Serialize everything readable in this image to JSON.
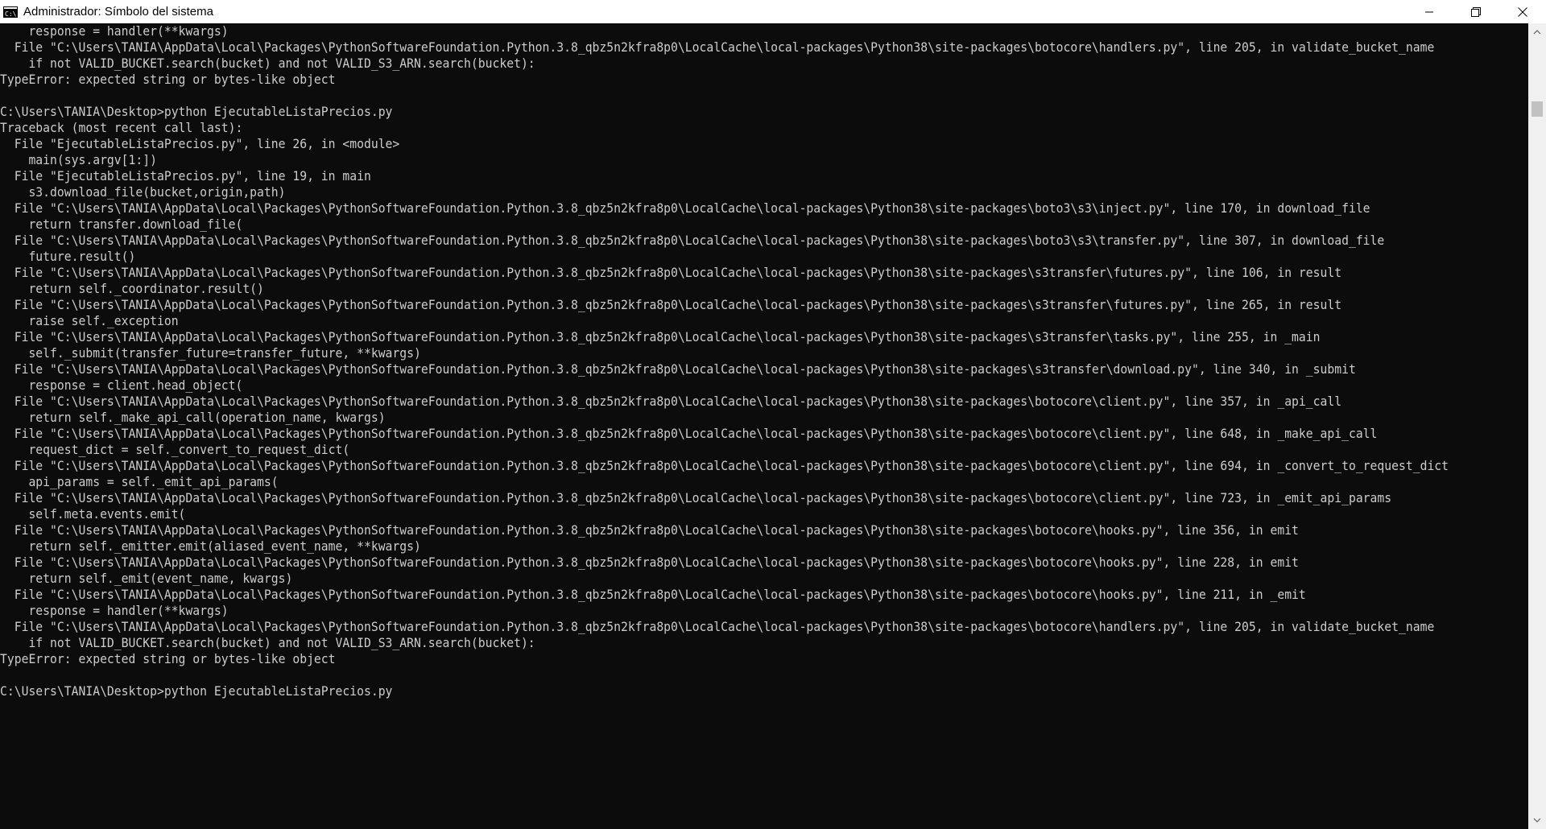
{
  "window": {
    "title": "Administrador: Símbolo del sistema",
    "icon": "cmd-icon",
    "controls": [
      "minimize-icon",
      "restore-icon",
      "close-icon"
    ]
  },
  "console": {
    "lines": [
      "    response = handler(**kwargs)",
      "  File \"C:\\Users\\TANIA\\AppData\\Local\\Packages\\PythonSoftwareFoundation.Python.3.8_qbz5n2kfra8p0\\LocalCache\\local-packages\\Python38\\site-packages\\botocore\\handlers.py\", line 205, in validate_bucket_name",
      "    if not VALID_BUCKET.search(bucket) and not VALID_S3_ARN.search(bucket):",
      "TypeError: expected string or bytes-like object",
      "",
      "C:\\Users\\TANIA\\Desktop>python EjecutableListaPrecios.py",
      "Traceback (most recent call last):",
      "  File \"EjecutableListaPrecios.py\", line 26, in <module>",
      "    main(sys.argv[1:])",
      "  File \"EjecutableListaPrecios.py\", line 19, in main",
      "    s3.download_file(bucket,origin,path)",
      "  File \"C:\\Users\\TANIA\\AppData\\Local\\Packages\\PythonSoftwareFoundation.Python.3.8_qbz5n2kfra8p0\\LocalCache\\local-packages\\Python38\\site-packages\\boto3\\s3\\inject.py\", line 170, in download_file",
      "    return transfer.download_file(",
      "  File \"C:\\Users\\TANIA\\AppData\\Local\\Packages\\PythonSoftwareFoundation.Python.3.8_qbz5n2kfra8p0\\LocalCache\\local-packages\\Python38\\site-packages\\boto3\\s3\\transfer.py\", line 307, in download_file",
      "    future.result()",
      "  File \"C:\\Users\\TANIA\\AppData\\Local\\Packages\\PythonSoftwareFoundation.Python.3.8_qbz5n2kfra8p0\\LocalCache\\local-packages\\Python38\\site-packages\\s3transfer\\futures.py\", line 106, in result",
      "    return self._coordinator.result()",
      "  File \"C:\\Users\\TANIA\\AppData\\Local\\Packages\\PythonSoftwareFoundation.Python.3.8_qbz5n2kfra8p0\\LocalCache\\local-packages\\Python38\\site-packages\\s3transfer\\futures.py\", line 265, in result",
      "    raise self._exception",
      "  File \"C:\\Users\\TANIA\\AppData\\Local\\Packages\\PythonSoftwareFoundation.Python.3.8_qbz5n2kfra8p0\\LocalCache\\local-packages\\Python38\\site-packages\\s3transfer\\tasks.py\", line 255, in _main",
      "    self._submit(transfer_future=transfer_future, **kwargs)",
      "  File \"C:\\Users\\TANIA\\AppData\\Local\\Packages\\PythonSoftwareFoundation.Python.3.8_qbz5n2kfra8p0\\LocalCache\\local-packages\\Python38\\site-packages\\s3transfer\\download.py\", line 340, in _submit",
      "    response = client.head_object(",
      "  File \"C:\\Users\\TANIA\\AppData\\Local\\Packages\\PythonSoftwareFoundation.Python.3.8_qbz5n2kfra8p0\\LocalCache\\local-packages\\Python38\\site-packages\\botocore\\client.py\", line 357, in _api_call",
      "    return self._make_api_call(operation_name, kwargs)",
      "  File \"C:\\Users\\TANIA\\AppData\\Local\\Packages\\PythonSoftwareFoundation.Python.3.8_qbz5n2kfra8p0\\LocalCache\\local-packages\\Python38\\site-packages\\botocore\\client.py\", line 648, in _make_api_call",
      "    request_dict = self._convert_to_request_dict(",
      "  File \"C:\\Users\\TANIA\\AppData\\Local\\Packages\\PythonSoftwareFoundation.Python.3.8_qbz5n2kfra8p0\\LocalCache\\local-packages\\Python38\\site-packages\\botocore\\client.py\", line 694, in _convert_to_request_dict",
      "    api_params = self._emit_api_params(",
      "  File \"C:\\Users\\TANIA\\AppData\\Local\\Packages\\PythonSoftwareFoundation.Python.3.8_qbz5n2kfra8p0\\LocalCache\\local-packages\\Python38\\site-packages\\botocore\\client.py\", line 723, in _emit_api_params",
      "    self.meta.events.emit(",
      "  File \"C:\\Users\\TANIA\\AppData\\Local\\Packages\\PythonSoftwareFoundation.Python.3.8_qbz5n2kfra8p0\\LocalCache\\local-packages\\Python38\\site-packages\\botocore\\hooks.py\", line 356, in emit",
      "    return self._emitter.emit(aliased_event_name, **kwargs)",
      "  File \"C:\\Users\\TANIA\\AppData\\Local\\Packages\\PythonSoftwareFoundation.Python.3.8_qbz5n2kfra8p0\\LocalCache\\local-packages\\Python38\\site-packages\\botocore\\hooks.py\", line 228, in emit",
      "    return self._emit(event_name, kwargs)",
      "  File \"C:\\Users\\TANIA\\AppData\\Local\\Packages\\PythonSoftwareFoundation.Python.3.8_qbz5n2kfra8p0\\LocalCache\\local-packages\\Python38\\site-packages\\botocore\\hooks.py\", line 211, in _emit",
      "    response = handler(**kwargs)",
      "  File \"C:\\Users\\TANIA\\AppData\\Local\\Packages\\PythonSoftwareFoundation.Python.3.8_qbz5n2kfra8p0\\LocalCache\\local-packages\\Python38\\site-packages\\botocore\\handlers.py\", line 205, in validate_bucket_name",
      "    if not VALID_BUCKET.search(bucket) and not VALID_S3_ARN.search(bucket):",
      "TypeError: expected string or bytes-like object",
      "",
      "C:\\Users\\TANIA\\Desktop>python EjecutableListaPrecios.py"
    ]
  },
  "scrollbar": {
    "position": 0.02,
    "visible_fraction": 0.02,
    "up_icon": "scroll-up-arrow-icon",
    "down_icon": "scroll-down-arrow-icon"
  },
  "colors": {
    "console_background": "#0c0c0c",
    "console_text": "#cccccc",
    "titlebar_background": "#ffffff"
  }
}
